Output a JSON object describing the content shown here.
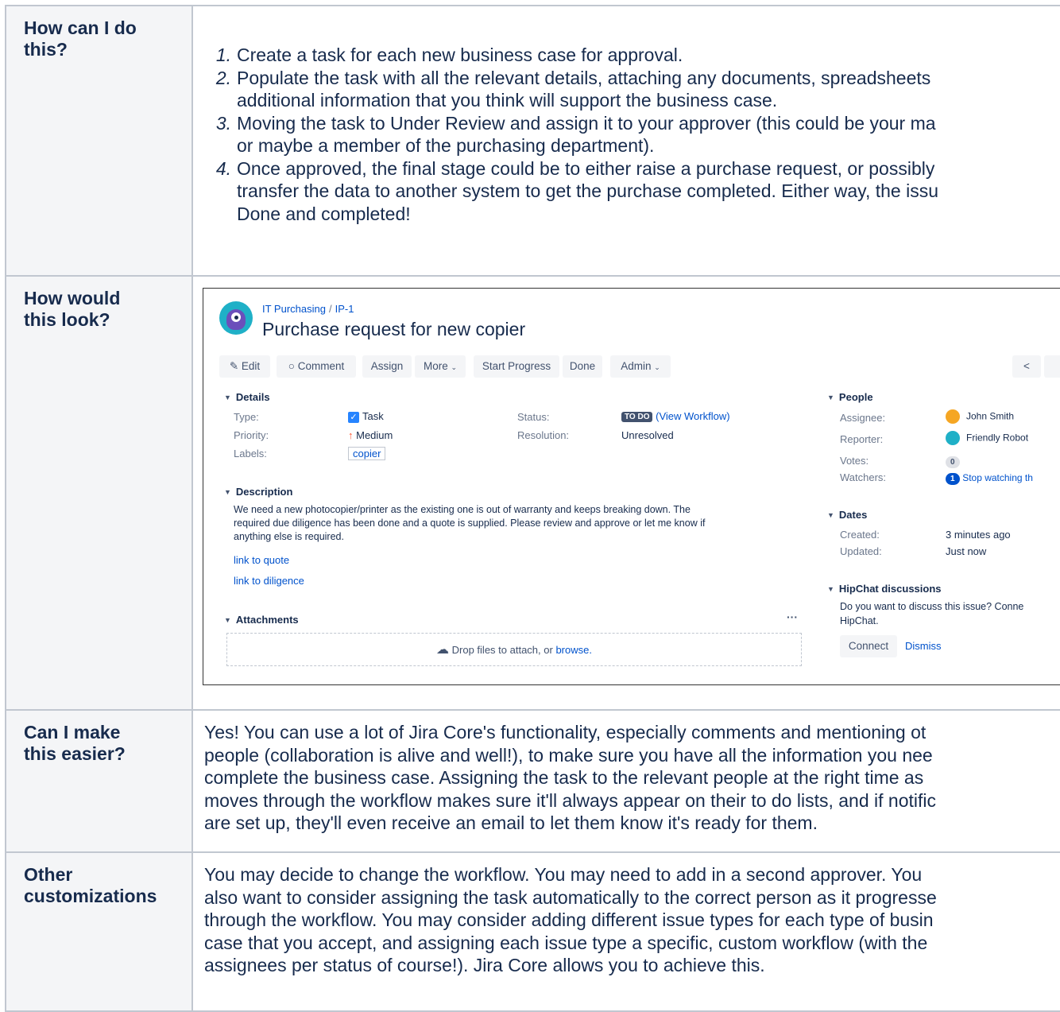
{
  "rows": [
    {
      "header": [
        "How can I do",
        "this?"
      ]
    },
    {
      "header": [
        "How would",
        "this look?"
      ]
    },
    {
      "header": [
        "Can I make",
        "this easier?"
      ]
    },
    {
      "header": [
        "Other",
        "customizations"
      ]
    }
  ],
  "steps": [
    {
      "num": "1.",
      "lines": [
        "Create a task for each new business case for approval."
      ]
    },
    {
      "num": "2.",
      "lines": [
        "Populate the task with all the relevant details, attaching any documents, spreadsheets",
        "additional information that you think will support the business case."
      ]
    },
    {
      "num": "3.",
      "lines": [
        "Moving the task to Under Review and assign it to your approver (this could be your ma",
        "or maybe a member of the purchasing department)."
      ]
    },
    {
      "num": "4.",
      "lines": [
        "Once approved, the final stage could be to either raise a purchase request, or possibly",
        "transfer the data to another system to get the purchase completed. Either way, the issu",
        "Done and completed!"
      ]
    }
  ],
  "easier_lines": [
    "Yes! You can use a lot of Jira Core's functionality, especially comments and mentioning ot",
    "people (collaboration is alive and well!), to make sure you have all the information you nee",
    "complete the business case. Assigning the task to the relevant people at the right time as",
    "moves through the workflow makes sure it'll always appear on their to do lists, and if notific",
    "are set up, they'll even receive an email to let them know it's ready for them."
  ],
  "custom_lines": [
    "You may decide to change the workflow. You may need to add in a second approver. You",
    "also want to consider assigning the task automatically to the correct person as it progresse",
    "through the workflow. You may consider adding different issue types for each type of busin",
    "case that you accept, and assigning each issue type a specific, custom workflow (with the",
    "assignees per status of course!). Jira Core allows you to achieve this."
  ],
  "jira": {
    "project": "IT Purchasing",
    "breadcrumb_sep": "/",
    "issue_key": "IP-1",
    "title": "Purchase request for new copier",
    "buttons": {
      "edit": "Edit",
      "comment": "Comment",
      "assign": "Assign",
      "more": "More",
      "start_progress": "Start Progress",
      "done": "Done",
      "admin": "Admin"
    },
    "details": {
      "heading": "Details",
      "type_label": "Type:",
      "type_value": "Task",
      "priority_label": "Priority:",
      "priority_value": "Medium",
      "labels_label": "Labels:",
      "labels_value": "copier",
      "status_label": "Status:",
      "status_badge": "TO DO",
      "view_workflow": "(View Workflow)",
      "resolution_label": "Resolution:",
      "resolution_value": "Unresolved"
    },
    "description": {
      "heading": "Description",
      "lines": [
        "We need a new photocopier/printer as the existing one is out of warranty and keeps breaking down. The",
        "required due diligence has been done and a quote is supplied. Please review and approve or let me know if",
        "anything else is required."
      ],
      "link1": "link to quote",
      "link2": "link to diligence"
    },
    "attachments": {
      "heading": "Attachments",
      "more": "···",
      "drop_text": "Drop files to attach, or",
      "browse": "browse."
    },
    "people": {
      "heading": "People",
      "assignee_label": "Assignee:",
      "assignee_value": "John Smith",
      "reporter_label": "Reporter:",
      "reporter_value": "Friendly Robot",
      "votes_label": "Votes:",
      "votes_value": "0",
      "watchers_label": "Watchers:",
      "watchers_count": "1",
      "watchers_link": "Stop watching th"
    },
    "dates": {
      "heading": "Dates",
      "created_label": "Created:",
      "created_value": "3 minutes ago",
      "updated_label": "Updated:",
      "updated_value": "Just now"
    },
    "hipchat": {
      "heading": "HipChat discussions",
      "line1": "Do you want to discuss this issue? Conne",
      "line2": "HipChat.",
      "connect": "Connect",
      "dismiss": "Dismiss"
    }
  }
}
